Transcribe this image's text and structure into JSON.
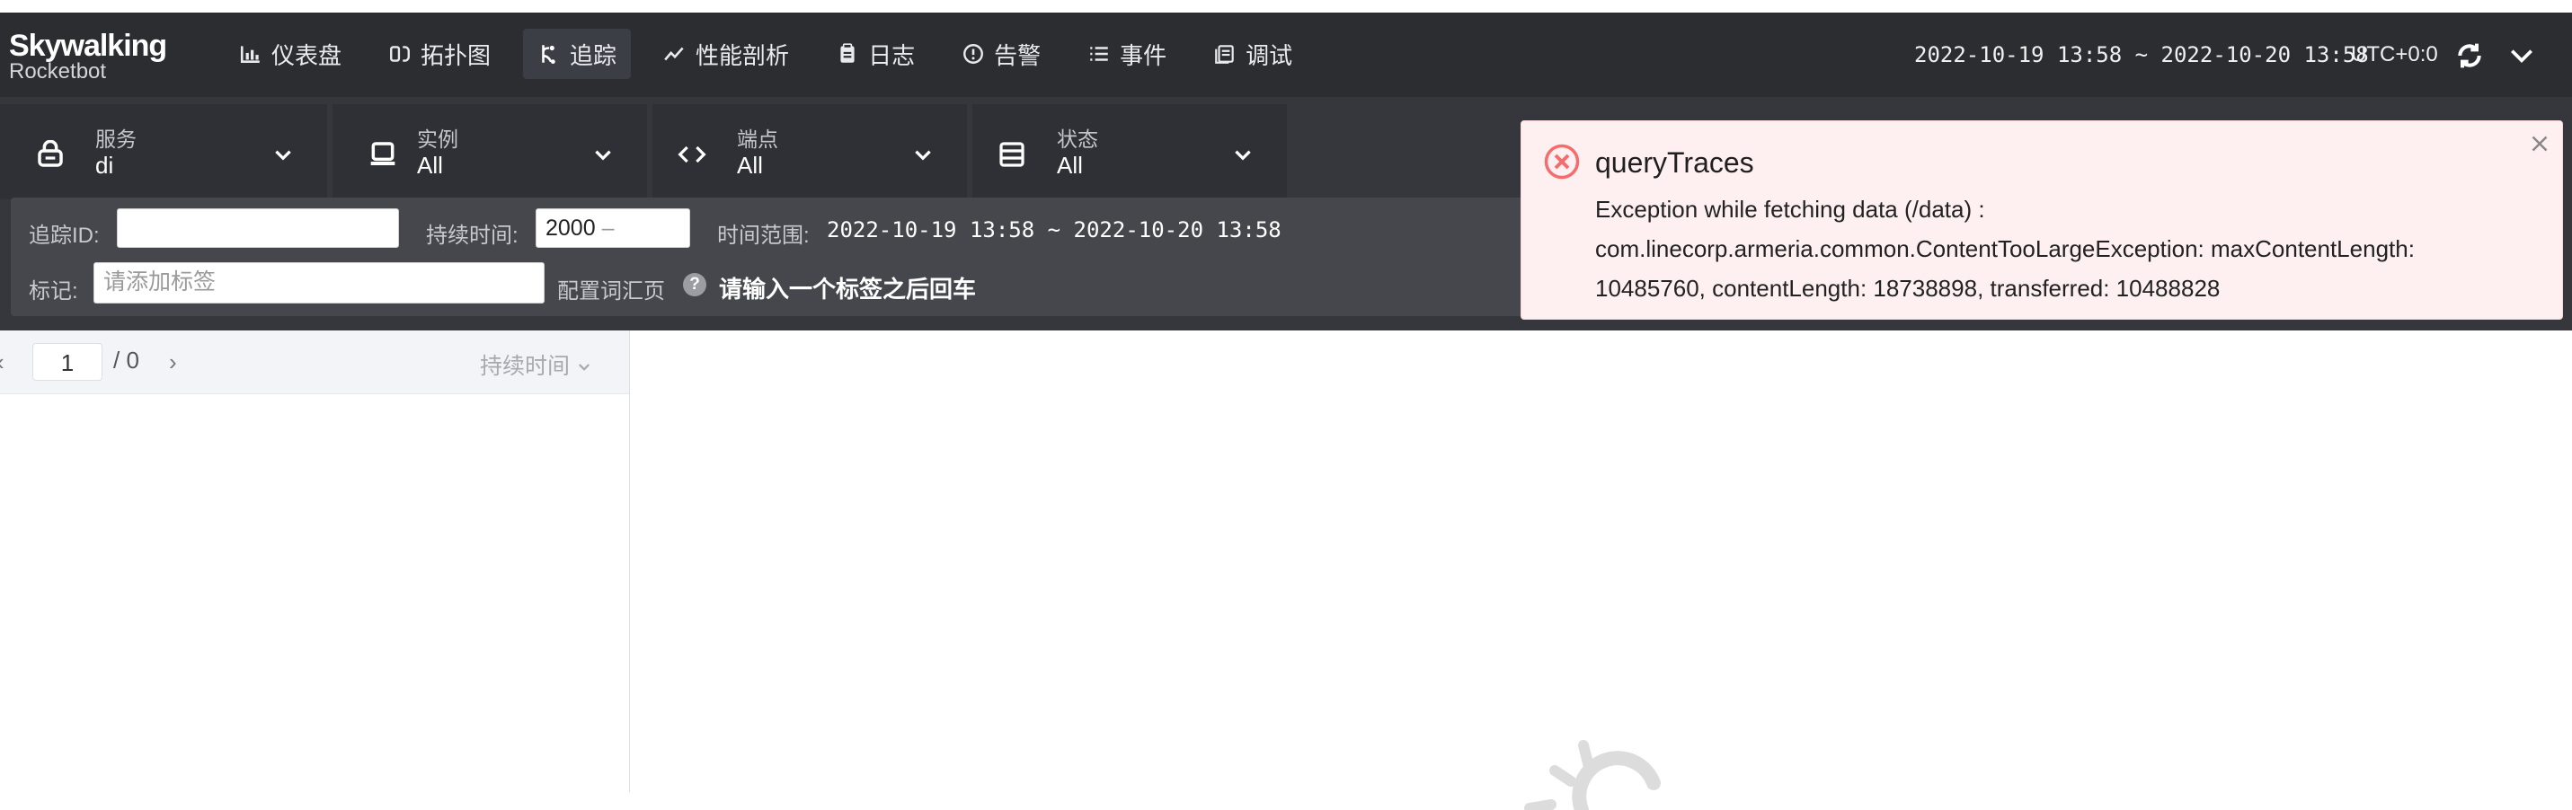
{
  "app": {
    "brand": "Skywalking",
    "sub": "Rocketbot"
  },
  "nav": [
    {
      "label": "仪表盘",
      "icon": "bar-chart-icon",
      "active": false
    },
    {
      "label": "拓扑图",
      "icon": "topology-icon",
      "active": false
    },
    {
      "label": "追踪",
      "icon": "trace-icon",
      "active": true
    },
    {
      "label": "性能剖析",
      "icon": "trend-icon",
      "active": false
    },
    {
      "label": "日志",
      "icon": "log-icon",
      "active": false
    },
    {
      "label": "告警",
      "icon": "alarm-icon",
      "active": false
    },
    {
      "label": "事件",
      "icon": "list-icon",
      "active": false
    },
    {
      "label": "调试",
      "icon": "debug-icon",
      "active": false
    }
  ],
  "header": {
    "time_range": "2022-10-19 13:58 ~ 2022-10-20 13:58",
    "timezone": "UTC+0:0"
  },
  "selectors": [
    {
      "caption": "服务",
      "value": "di",
      "icon": "service-icon"
    },
    {
      "caption": "实例",
      "value": "All",
      "icon": "instance-icon"
    },
    {
      "caption": "端点",
      "value": "All",
      "icon": "endpoint-icon"
    },
    {
      "caption": "状态",
      "value": "All",
      "icon": "status-icon"
    }
  ],
  "filters": {
    "trace_id_label": "追踪ID:",
    "trace_id_value": "",
    "duration_label": "持续时间:",
    "duration_min": "2000",
    "duration_sep": "–",
    "time_range_label": "时间范围:",
    "time_range_value": "2022-10-19 13:58 ~ 2022-10-20 13:58",
    "tags_label": "标记:",
    "tags_placeholder": "请添加标签",
    "vocab_link": "配置词汇页",
    "help_glyph": "?",
    "tags_hint": "请输入一个标签之后回车"
  },
  "pager": {
    "prev": "‹",
    "page": "1",
    "total": "/ 0",
    "next": "›",
    "sort_label": "持续时间"
  },
  "toast": {
    "title": "queryTraces",
    "message": "Exception while fetching data (/data) : com.linecorp.armeria.common.ContentTooLargeException: maxContentLength: 10485760, contentLength: 18738898, transferred: 10488828"
  },
  "colors": {
    "topbar": "#2b2d31",
    "toolbar": "#35373c",
    "error": "#f56c6c"
  }
}
